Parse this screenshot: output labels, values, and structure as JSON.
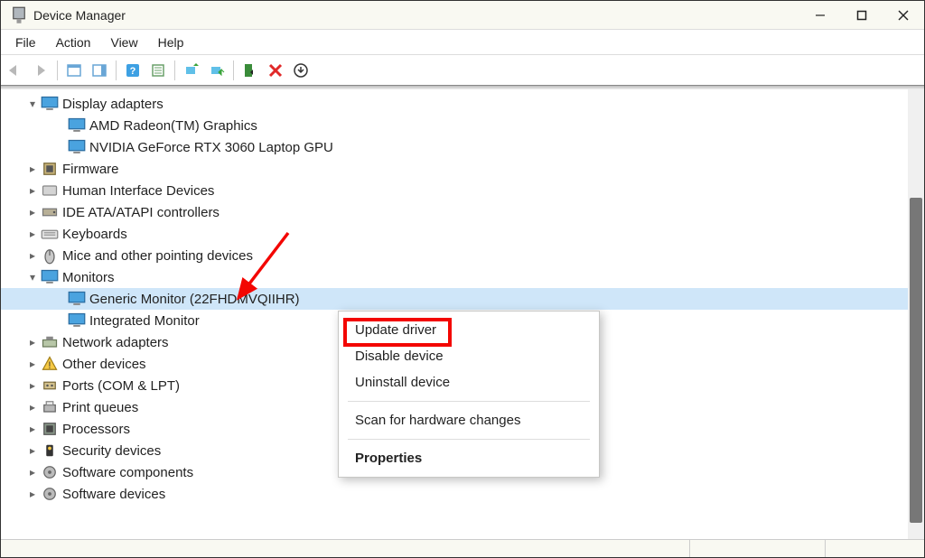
{
  "window": {
    "title": "Device Manager"
  },
  "menu": {
    "file": "File",
    "action": "Action",
    "view": "View",
    "help": "Help"
  },
  "tree": {
    "categories": [
      {
        "label": "Display adapters",
        "expanded": true,
        "icon": "display",
        "children": [
          {
            "label": "AMD Radeon(TM) Graphics"
          },
          {
            "label": "NVIDIA GeForce RTX 3060 Laptop GPU"
          }
        ]
      },
      {
        "label": "Firmware",
        "expanded": false,
        "icon": "firmware"
      },
      {
        "label": "Human Interface Devices",
        "expanded": false,
        "icon": "hid"
      },
      {
        "label": "IDE ATA/ATAPI controllers",
        "expanded": false,
        "icon": "ide"
      },
      {
        "label": "Keyboards",
        "expanded": false,
        "icon": "keyboard"
      },
      {
        "label": "Mice and other pointing devices",
        "expanded": false,
        "icon": "mouse"
      },
      {
        "label": "Monitors",
        "expanded": true,
        "icon": "monitor",
        "children": [
          {
            "label": "Generic Monitor (22FHDMVQIIHR)",
            "selected": true
          },
          {
            "label": "Integrated Monitor"
          }
        ]
      },
      {
        "label": "Network adapters",
        "expanded": false,
        "icon": "network"
      },
      {
        "label": "Other devices",
        "expanded": false,
        "icon": "other"
      },
      {
        "label": "Ports (COM & LPT)",
        "expanded": false,
        "icon": "port"
      },
      {
        "label": "Print queues",
        "expanded": false,
        "icon": "print"
      },
      {
        "label": "Processors",
        "expanded": false,
        "icon": "cpu"
      },
      {
        "label": "Security devices",
        "expanded": false,
        "icon": "security"
      },
      {
        "label": "Software components",
        "expanded": false,
        "icon": "software"
      },
      {
        "label": "Software devices",
        "expanded": false,
        "icon": "software"
      }
    ]
  },
  "context_menu": {
    "update_driver": "Update driver",
    "disable_device": "Disable device",
    "uninstall_device": "Uninstall device",
    "scan": "Scan for hardware changes",
    "properties": "Properties"
  },
  "colors": {
    "highlight": "#f30602",
    "selection": "#cfe6f9"
  }
}
